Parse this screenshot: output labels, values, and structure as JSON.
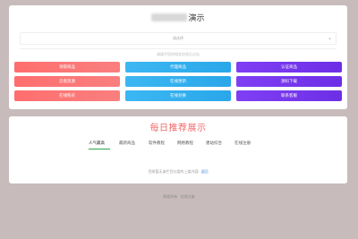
{
  "header": {
    "title_suffix": "演示"
  },
  "select": {
    "value": "请选择",
    "chevron_icon": "chevron-down-icon"
  },
  "hint": "请填写您的相关信息后点击",
  "buttons": [
    {
      "label": "领取商品",
      "color": "#ff6e6e"
    },
    {
      "label": "代理商品",
      "color": "#3cb7f2"
    },
    {
      "label": "认证商品",
      "color": "#7f3ff4"
    },
    {
      "label": "云盘资源",
      "color": "#ff6e6e"
    },
    {
      "label": "在线更新",
      "color": "#3cb7f2"
    },
    {
      "label": "源码下载",
      "color": "#7f3ff4"
    },
    {
      "label": "在线购买",
      "color": "#ff6e6e"
    },
    {
      "label": "在线兑换",
      "color": "#3cb7f2"
    },
    {
      "label": "联系客服",
      "color": "#7f3ff4"
    }
  ],
  "recommend": {
    "title": "每日推荐展示",
    "tabs": [
      "人气最高",
      "最新商品",
      "软件教程",
      "网络教程",
      "建站综合",
      "在线注册"
    ],
    "active_tab": "人气最高",
    "accent": "#2ba84a",
    "notice": "目前暂无该栏目分类的上架内容!",
    "notice_link": "返回"
  },
  "footer": "版权所有 · 在线注册"
}
